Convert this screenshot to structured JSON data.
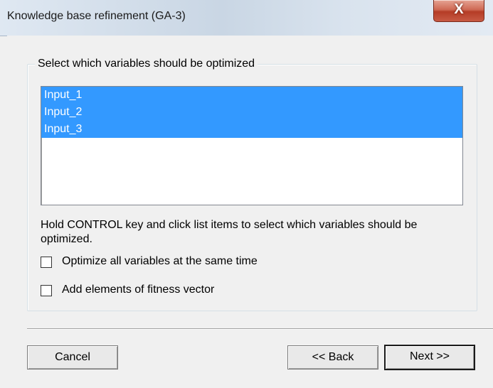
{
  "window": {
    "title": "Knowledge base refinement (GA-3)",
    "close_glyph": "X"
  },
  "group": {
    "label": "Select which variables should be optimized",
    "list_items": [
      {
        "label": "Input_1",
        "selected": true
      },
      {
        "label": "Input_2",
        "selected": true
      },
      {
        "label": "Input_3",
        "selected": true
      }
    ],
    "hint": "Hold CONTROL key and click list items to select which variables should be optimized.",
    "checkboxes": [
      {
        "label": "Optimize all variables at the same time",
        "checked": false
      },
      {
        "label": "Add elements of fitness vector",
        "checked": false
      }
    ]
  },
  "buttons": {
    "cancel": "Cancel",
    "back": "<< Back",
    "next": "Next >>"
  },
  "colors": {
    "selection": "#3399ff",
    "close_button": "#c75a44"
  }
}
